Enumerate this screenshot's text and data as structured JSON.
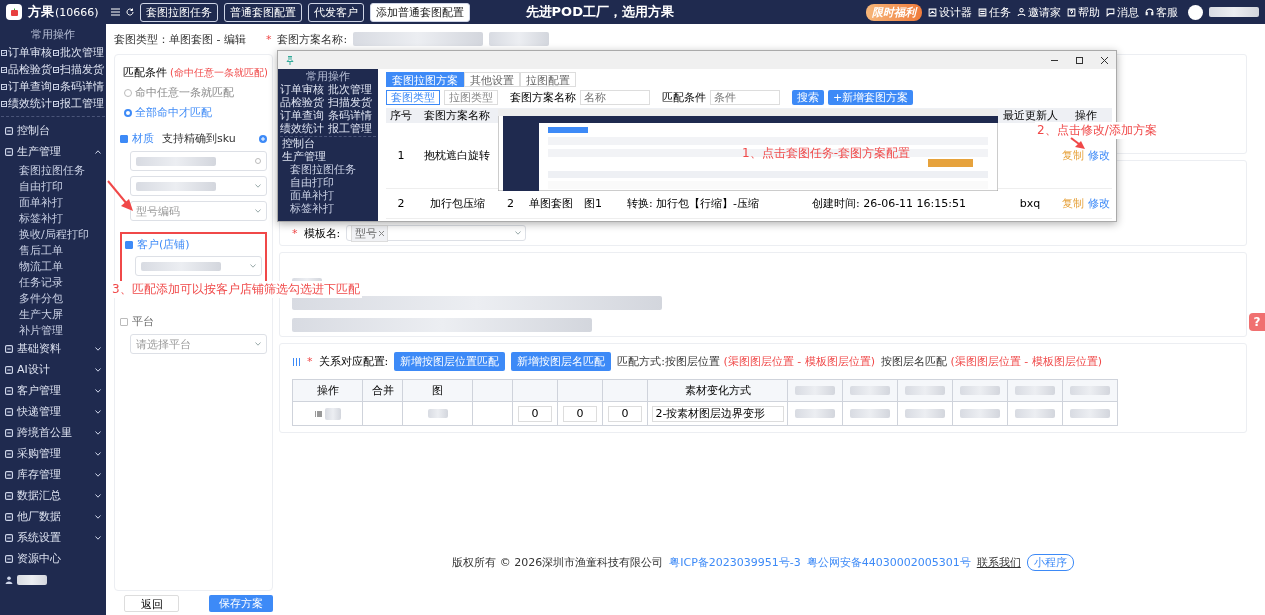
{
  "header": {
    "brand": "方果",
    "count": "(10666)",
    "tabs": [
      {
        "label": "套图拉图任务",
        "selected": false
      },
      {
        "label": "普通套图配置",
        "selected": false
      },
      {
        "label": "代发客户",
        "selected": false
      },
      {
        "label": "添加普通套图配置",
        "selected": true
      }
    ],
    "slogan": "先进POD工厂，选用方果",
    "promo": "限时福利",
    "tools": [
      {
        "kind": "image",
        "label": "设计器"
      },
      {
        "kind": "task",
        "label": "任务"
      },
      {
        "kind": "users",
        "label": "邀请家"
      },
      {
        "kind": "help",
        "label": "帮助"
      },
      {
        "kind": "message",
        "label": "消息"
      },
      {
        "kind": "service",
        "label": "客服"
      }
    ]
  },
  "sidebar": {
    "quick_title": "常用操作",
    "quick_actions": [
      "订单审核",
      "批次管理",
      "品检验货",
      "扫描发货",
      "订单查询",
      "条码详情",
      "绩效统计",
      "报工管理"
    ],
    "nav": [
      {
        "label": "控制台",
        "kind": "link"
      },
      {
        "label": "生产管理",
        "kind": "group",
        "expanded": true,
        "children": [
          "套图拉图任务",
          "自由打印",
          "面单补打",
          "标签补打",
          "换收/局程打印",
          "售后工单",
          "物流工单",
          "任务记录",
          "多件分包",
          "生产大屏",
          "补片管理"
        ]
      },
      {
        "label": "基础资料",
        "kind": "group",
        "expanded": false
      },
      {
        "label": "AI设计",
        "kind": "group",
        "expanded": false
      },
      {
        "label": "客户管理",
        "kind": "group",
        "expanded": false
      },
      {
        "label": "快递管理",
        "kind": "group",
        "expanded": false
      },
      {
        "label": "跨境首公里",
        "kind": "group",
        "expanded": false
      },
      {
        "label": "采购管理",
        "kind": "group",
        "expanded": false
      },
      {
        "label": "库存管理",
        "kind": "group",
        "expanded": false
      },
      {
        "label": "数据汇总",
        "kind": "group",
        "expanded": false
      },
      {
        "label": "他厂数据",
        "kind": "group",
        "expanded": false
      },
      {
        "label": "系统设置",
        "kind": "group",
        "expanded": false
      },
      {
        "label": "资源中心",
        "kind": "link"
      }
    ]
  },
  "page": {
    "type_label": "套图类型：单图套图 - 编辑",
    "required_mark": "*",
    "name_label": "套图方案名称:"
  },
  "match_panel": {
    "title": "匹配条件",
    "hint": "(命中任意一条就匹配)",
    "modes": [
      {
        "label": "命中任意一条就匹配",
        "selected": false
      },
      {
        "label": "全部命中才匹配",
        "selected": true
      }
    ],
    "conditions": [
      {
        "label": "材质",
        "checked": true,
        "note": "支持精确到sku",
        "fields": [
          {
            "kind": "clear"
          },
          {
            "kind": "select"
          },
          {
            "kind": "select",
            "placeholder": "型号编码"
          }
        ]
      },
      {
        "label": "客户(店铺)",
        "checked": true,
        "fields": [
          {
            "kind": "select"
          }
        ]
      },
      {
        "label": "平台",
        "checked": false,
        "fields": [
          {
            "kind": "select",
            "placeholder": "请选择平台"
          }
        ]
      }
    ]
  },
  "template": {
    "label": "模板名:",
    "tag": "型号"
  },
  "relation": {
    "label": "关系对应配置:",
    "buttons": [
      "新增按图层位置匹配",
      "新增按图层名匹配"
    ],
    "notes": [
      {
        "text": "匹配方式:按图层位置",
        "detail": "(渠图图层位置 - 模板图层位置)"
      },
      {
        "text": "按图层名匹配",
        "detail": "(渠图图层位置 - 模板图层位置)"
      }
    ],
    "columns": [
      "操作",
      "合并",
      "图",
      "",
      "",
      "",
      "",
      "素材变化方式"
    ],
    "numbers": [
      "0",
      "0",
      "0"
    ],
    "transform": "2-按素材图层边界变形"
  },
  "actions": {
    "back": "返回",
    "save": "保存方案"
  },
  "footer": {
    "copyright": "版权所有 © 2026深圳市渔童科技有限公司",
    "icp": "粤ICP备2023039951号-3",
    "police": "粤公网安备44030002005301号",
    "contact": "联系我们",
    "mini": "小程序"
  },
  "help_tab": "?",
  "overlay": {
    "sidebar_title": "常用操作",
    "quick_actions": [
      "订单审核",
      "批次管理",
      "品检验货",
      "扫描发货",
      "订单查询",
      "条码详情",
      "绩效统计",
      "报工管理"
    ],
    "nav": [
      "控制台",
      "生产管理"
    ],
    "sub_nav": [
      "套图拉图任务",
      "自由打印",
      "面单补打",
      "标签补打"
    ],
    "tabs": [
      {
        "label": "套图拉图方案",
        "selected": true
      },
      {
        "label": "其他设置",
        "selected": false
      },
      {
        "label": "拉图配置",
        "selected": false
      }
    ],
    "types": [
      {
        "label": "套图类型",
        "selected": true
      },
      {
        "label": "拉图类型",
        "selected": false
      }
    ],
    "filters": [
      {
        "label": "套图方案名称",
        "placeholder": "名称"
      },
      {
        "label": "匹配条件",
        "placeholder": "条件"
      }
    ],
    "search": "搜索",
    "add": "+新增套图方案",
    "columns": [
      "序号",
      "套图方案名称",
      "",
      "",
      "",
      "",
      "",
      "最近更新人",
      "操作"
    ],
    "rows": [
      {
        "cells": [
          "1",
          "抱枕遮白旋转",
          "",
          "",
          "",
          "",
          "",
          ""
        ],
        "ops": [
          "复制",
          "修改"
        ]
      },
      {
        "cells": [
          "2",
          "加行包压缩",
          "2",
          "单图套图",
          "图1",
          "转换: 加行包【行缩】-压缩",
          "创建时间: 26-06-11 16:15:51",
          "bxq"
        ],
        "ops": [
          "复制",
          "修改"
        ]
      }
    ]
  },
  "annotations": [
    "1、点击套图任务-套图方案配置",
    "2、点击修改/添加方案",
    "3、匹配添加可以按客户店铺筛选勾选进下匹配"
  ]
}
